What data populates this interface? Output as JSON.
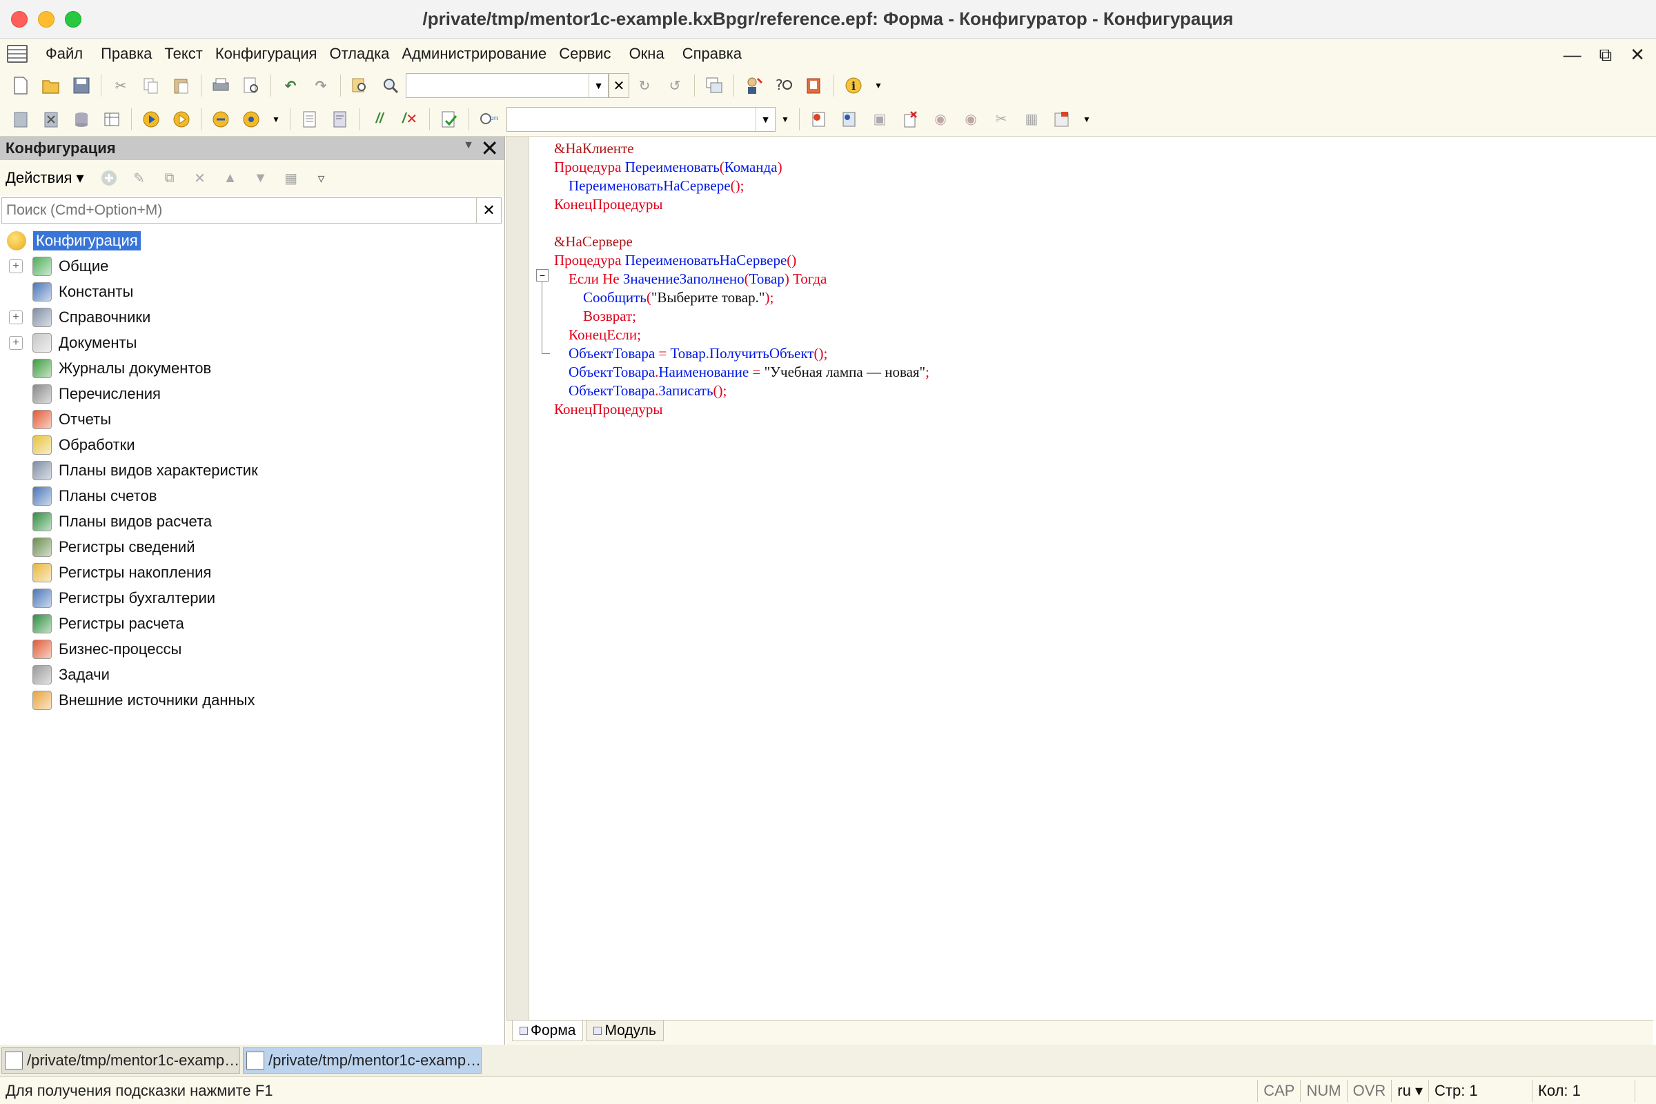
{
  "window": {
    "title": "/private/tmp/mentor1c-example.kxBpgr/reference.epf: Форма - Конфигуратор - Конфигурация"
  },
  "menu": [
    {
      "label": "Файл",
      "name": "menu-file"
    },
    {
      "label": "Правка",
      "name": "menu-edit"
    },
    {
      "label": "Текст",
      "name": "menu-text"
    },
    {
      "label": "Конфигурация",
      "name": "menu-configuration"
    },
    {
      "label": "Отладка",
      "name": "menu-debug"
    },
    {
      "label": "Администрирование",
      "name": "menu-administration"
    },
    {
      "label": "Сервис",
      "name": "menu-service"
    },
    {
      "label": "Окна",
      "name": "menu-windows"
    },
    {
      "label": "Справка",
      "name": "menu-help"
    }
  ],
  "toolbar": {
    "search_combo_value": "",
    "module_combo_value": ""
  },
  "config_panel": {
    "title": "Конфигурация",
    "actions_label": "Действия",
    "search_placeholder": "Поиск (Cmd+Option+M)",
    "tree": [
      {
        "label": "Конфигурация",
        "icon": "config-root-icon",
        "expander": false,
        "color": "#f2c23a"
      },
      {
        "label": "Общие",
        "icon": "common-icon",
        "expander": true,
        "color": "#4fae5b"
      },
      {
        "label": "Константы",
        "icon": "constants-icon",
        "expander": false,
        "color": "#4a77b9"
      },
      {
        "label": "Справочники",
        "icon": "catalogs-icon",
        "expander": true,
        "color": "#7f8fa6"
      },
      {
        "label": "Документы",
        "icon": "documents-icon",
        "expander": true,
        "color": "#c7c7c7"
      },
      {
        "label": "Журналы документов",
        "icon": "document-journals-icon",
        "expander": false,
        "color": "#3d9d3d"
      },
      {
        "label": "Перечисления",
        "icon": "enums-icon",
        "expander": false,
        "color": "#8a8a8a"
      },
      {
        "label": "Отчеты",
        "icon": "reports-icon",
        "expander": false,
        "color": "#e35b35"
      },
      {
        "label": "Обработки",
        "icon": "data-processors-icon",
        "expander": false,
        "color": "#e8c23e"
      },
      {
        "label": "Планы видов характеристик",
        "icon": "chart-of-characteristic-types-icon",
        "expander": false,
        "color": "#7f8fa6"
      },
      {
        "label": "Планы счетов",
        "icon": "chart-of-accounts-icon",
        "expander": false,
        "color": "#4a77b9"
      },
      {
        "label": "Планы видов расчета",
        "icon": "chart-of-calculation-types-icon",
        "expander": false,
        "color": "#2f8f3f"
      },
      {
        "label": "Регистры сведений",
        "icon": "information-registers-icon",
        "expander": false,
        "color": "#6b8e4e"
      },
      {
        "label": "Регистры накопления",
        "icon": "accumulation-registers-icon",
        "expander": false,
        "color": "#e8b83e"
      },
      {
        "label": "Регистры бухгалтерии",
        "icon": "accounting-registers-icon",
        "expander": false,
        "color": "#4a77b9"
      },
      {
        "label": "Регистры расчета",
        "icon": "calculation-registers-icon",
        "expander": false,
        "color": "#2f8f3f"
      },
      {
        "label": "Бизнес-процессы",
        "icon": "business-processes-icon",
        "expander": false,
        "color": "#e35b35"
      },
      {
        "label": "Задачи",
        "icon": "tasks-icon",
        "expander": false,
        "color": "#9a9a9a"
      },
      {
        "label": "Внешние источники данных",
        "icon": "external-data-sources-icon",
        "expander": false,
        "color": "#e8a43e"
      }
    ]
  },
  "code": {
    "lines": [
      [
        {
          "t": "&НаКлиенте",
          "c": "pre"
        }
      ],
      [
        {
          "t": "Процедура ",
          "c": "kw"
        },
        {
          "t": "Переименовать",
          "c": "id"
        },
        {
          "t": "(",
          "c": "kw"
        },
        {
          "t": "Команда",
          "c": "id"
        },
        {
          "t": ")",
          "c": "kw"
        }
      ],
      [
        {
          "t": "    ",
          "c": "str"
        },
        {
          "t": "ПереименоватьНаСервере",
          "c": "id"
        },
        {
          "t": "();",
          "c": "kw"
        }
      ],
      [
        {
          "t": "КонецПроцедуры",
          "c": "kw"
        }
      ],
      [
        {
          "t": "",
          "c": "str"
        }
      ],
      [
        {
          "t": "&НаСервере",
          "c": "pre"
        }
      ],
      [
        {
          "t": "Процедура ",
          "c": "kw"
        },
        {
          "t": "ПереименоватьНаСервере",
          "c": "id"
        },
        {
          "t": "()",
          "c": "kw"
        }
      ],
      [
        {
          "t": "    ",
          "c": "str"
        },
        {
          "t": "Если Не ",
          "c": "kw"
        },
        {
          "t": "ЗначениеЗаполнено",
          "c": "id"
        },
        {
          "t": "(",
          "c": "kw"
        },
        {
          "t": "Товар",
          "c": "id"
        },
        {
          "t": ") Тогда",
          "c": "kw"
        }
      ],
      [
        {
          "t": "        ",
          "c": "str"
        },
        {
          "t": "Сообщить",
          "c": "id"
        },
        {
          "t": "(",
          "c": "kw"
        },
        {
          "t": "\"Выберите товар.\"",
          "c": "str"
        },
        {
          "t": ");",
          "c": "kw"
        }
      ],
      [
        {
          "t": "        ",
          "c": "str"
        },
        {
          "t": "Возврат;",
          "c": "kw"
        }
      ],
      [
        {
          "t": "    ",
          "c": "str"
        },
        {
          "t": "КонецЕсли;",
          "c": "kw"
        }
      ],
      [
        {
          "t": "    ",
          "c": "str"
        },
        {
          "t": "ОбъектТовара",
          "c": "id"
        },
        {
          "t": " = ",
          "c": "kw"
        },
        {
          "t": "Товар",
          "c": "id"
        },
        {
          "t": ".",
          "c": "kw"
        },
        {
          "t": "ПолучитьОбъект",
          "c": "id"
        },
        {
          "t": "();",
          "c": "kw"
        }
      ],
      [
        {
          "t": "    ",
          "c": "str"
        },
        {
          "t": "ОбъектТовара",
          "c": "id"
        },
        {
          "t": ".",
          "c": "kw"
        },
        {
          "t": "Наименование",
          "c": "id"
        },
        {
          "t": " = ",
          "c": "kw"
        },
        {
          "t": "\"Учебная лампа — новая\"",
          "c": "str"
        },
        {
          "t": ";",
          "c": "kw"
        }
      ],
      [
        {
          "t": "    ",
          "c": "str"
        },
        {
          "t": "ОбъектТовара",
          "c": "id"
        },
        {
          "t": ".",
          "c": "kw"
        },
        {
          "t": "Записать",
          "c": "id"
        },
        {
          "t": "();",
          "c": "kw"
        }
      ],
      [
        {
          "t": "КонецПроцедуры",
          "c": "kw"
        }
      ]
    ]
  },
  "editor_tabs": [
    {
      "label": "Форма",
      "active": true
    },
    {
      "label": "Модуль",
      "active": false
    }
  ],
  "window_tabs": [
    {
      "label": "/private/tmp/mentor1c-examp…",
      "active": false
    },
    {
      "label": "/private/tmp/mentor1c-examp…",
      "active": true
    }
  ],
  "status": {
    "hint": "Для получения подсказки нажмите F1",
    "cap": "CAP",
    "num": "NUM",
    "ovr": "OVR",
    "lang": "ru",
    "row": "Стр: 1",
    "col": "Кол: 1"
  }
}
